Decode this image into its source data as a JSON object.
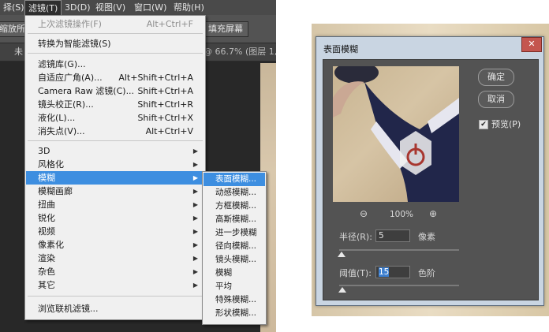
{
  "menubar": {
    "items": [
      "择(S)",
      "滤镜(T)",
      "3D(D)",
      "视图(V)",
      "窗口(W)",
      "帮助(H)"
    ]
  },
  "options_bar": {
    "left_text": "缩放所有",
    "fill_screen": "填充屏幕"
  },
  "tabbar": {
    "doc_tab": "@ 66.7% (图层 1, R",
    "left_stub": "未"
  },
  "filter_menu": {
    "last_filter": {
      "label": "上次滤镜操作(F)",
      "shortcut": "Alt+Ctrl+F"
    },
    "convert_smart": "转换为智能滤镜(S)",
    "group2": [
      {
        "label": "滤镜库(G)...",
        "shortcut": ""
      },
      {
        "label": "自适应广角(A)...",
        "shortcut": "Alt+Shift+Ctrl+A"
      },
      {
        "label": "Camera Raw 滤镜(C)...",
        "shortcut": "Shift+Ctrl+A"
      },
      {
        "label": "镜头校正(R)...",
        "shortcut": "Shift+Ctrl+R"
      },
      {
        "label": "液化(L)...",
        "shortcut": "Shift+Ctrl+X"
      },
      {
        "label": "消失点(V)...",
        "shortcut": "Alt+Ctrl+V"
      }
    ],
    "group3": [
      "3D",
      "风格化",
      "模糊",
      "模糊画廊",
      "扭曲",
      "锐化",
      "视频",
      "像素化",
      "渲染",
      "杂色",
      "其它"
    ],
    "browse": "浏览联机滤镜..."
  },
  "blur_submenu": {
    "items": [
      "表面模糊...",
      "动感模糊...",
      "方框模糊...",
      "高斯模糊...",
      "进一步模糊",
      "径向模糊...",
      "镜头模糊...",
      "模糊",
      "平均",
      "特殊模糊...",
      "形状模糊..."
    ]
  },
  "dialog": {
    "title": "表面模糊",
    "close": "✕",
    "ok_label": "确定",
    "cancel_label": "取消",
    "preview_label": "预览(P)",
    "preview_checked": true,
    "zoom_level": "100%",
    "radius": {
      "label": "半径(R):",
      "value": "5",
      "unit": "像素"
    },
    "threshold": {
      "label": "阈值(T):",
      "value": "15",
      "unit": "色阶"
    }
  }
}
